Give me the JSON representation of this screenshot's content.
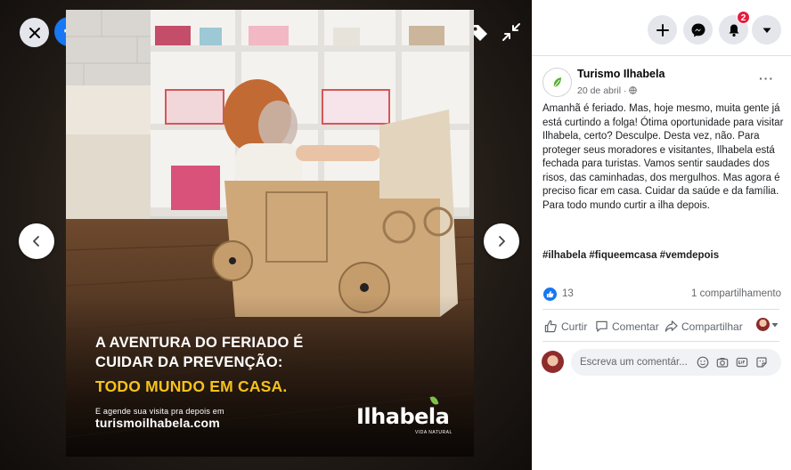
{
  "viewer": {
    "brand_letter": "f",
    "poster": {
      "headline_1": "A AVENTURA DO FERIADO É",
      "headline_2": "CUIDAR DA PREVENÇÃO:",
      "headline_3": "TODO MUNDO EM CASA.",
      "small_line": "E agende sua visita pra depois em",
      "url": "turismoilhabela.com",
      "brand": "Ilhabela",
      "brand_sub": "VIDA NATURAL"
    }
  },
  "header": {
    "notification_count": "2"
  },
  "post": {
    "page_name": "Turismo Ilhabela",
    "date": "20 de abril · ",
    "more_label": "···",
    "body": "Amanhã é feriado. Mas, hoje mesmo, muita gente já está curtindo a folga! Ótima oportunidade para visitar Ilhabela, certo? Desculpe. Desta vez, não. Para proteger seus moradores e visitantes, Ilhabela está fechada para turistas. Vamos sentir saudades dos risos, das caminhadas, dos mergulhos. Mas agora é preciso ficar em casa. Cuidar da saúde e da família. Para todo mundo curtir a ilha depois.",
    "hashtags": "#ilhabela #fiqueemcasa #vemdepois",
    "reaction_count": "13",
    "share_count": "1 compartilhamento",
    "actions": {
      "like": "Curtir",
      "comment": "Comentar",
      "share": "Compartilhar"
    },
    "comment_placeholder": "Escreva um comentár..."
  },
  "colors": {
    "facebook_blue": "#1877f2",
    "badge_red": "#e41e3f",
    "poster_yellow": "#f5c21b",
    "ilhabela_green": "#7ec14a"
  }
}
